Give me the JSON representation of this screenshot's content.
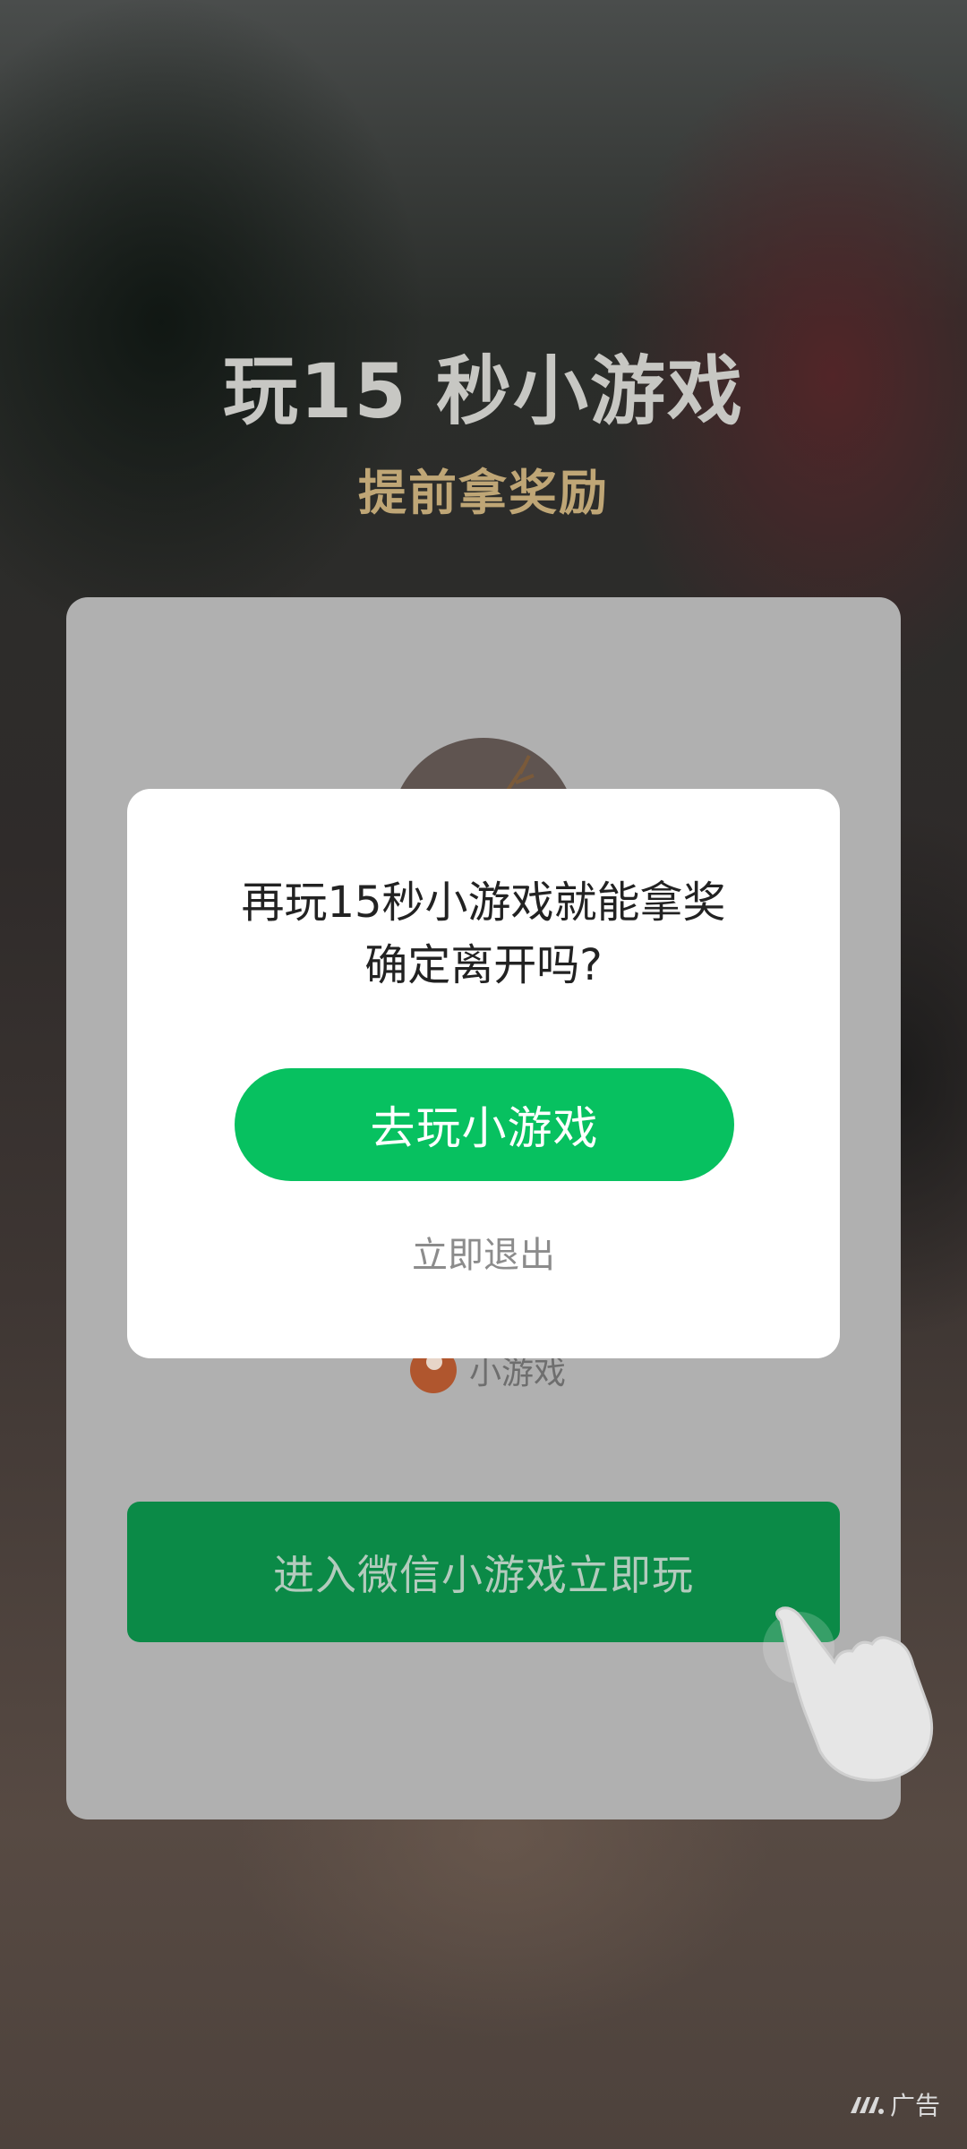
{
  "hero": {
    "title": "玩15 秒小游戏",
    "subtitle": "提前拿奖励"
  },
  "card": {
    "game_tag_label": "小游戏",
    "enter_button_label": "进入微信小游戏立即玩"
  },
  "dialog": {
    "message_line1": "再玩15秒小游戏就能拿奖",
    "message_line2": "确定离开吗?",
    "primary_label": "去玩小游戏",
    "secondary_label": "立即退出"
  },
  "ad_badge": {
    "label": "广告",
    "icon": "ad-logo-icon"
  },
  "colors": {
    "accent_green": "#07c160",
    "subtitle_gold": "#bfa676"
  }
}
